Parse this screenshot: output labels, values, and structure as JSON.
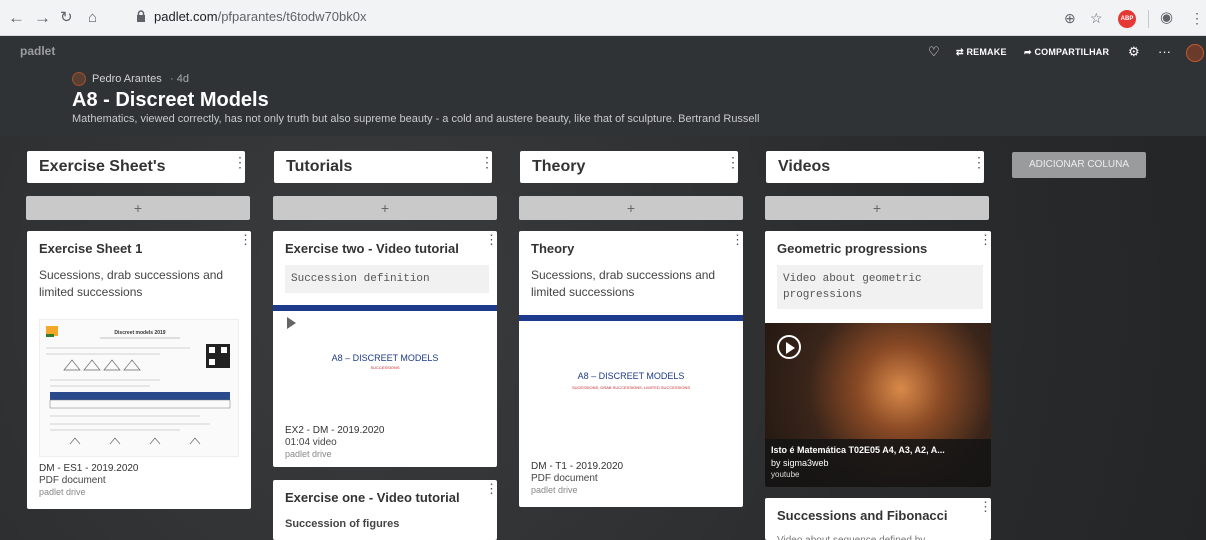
{
  "browser": {
    "url_host": "padlet.com",
    "url_path": "/pfparantes/t6todw70bk0x"
  },
  "header": {
    "logo": "padlet",
    "author": "Pedro Arantes",
    "time": "· 4d",
    "title": "A8 - Discreet Models",
    "subtitle": "Mathematics, viewed correctly, has not only truth but also supreme beauty - a cold and austere beauty, like that of sculpture. Bertrand Russell",
    "remake_label": "⇄ REMAKE",
    "share_label": "➦ COMPARTILHAR"
  },
  "columns": [
    {
      "title": "Exercise Sheet's"
    },
    {
      "title": "Tutorials"
    },
    {
      "title": "Theory"
    },
    {
      "title": "Videos"
    }
  ],
  "add_column_label": "ADICIONAR COLUNA",
  "add_symbol": "+",
  "cards": {
    "ex1": {
      "title": "Exercise Sheet 1",
      "body": "Sucessions, drab successions and limited successions",
      "thumb_title": "Discreet models 2019",
      "att_title": "DM - ES1 - 2019.2020",
      "att_type": "PDF document",
      "att_src": "padlet drive"
    },
    "tut2": {
      "title": "Exercise two - Video tutorial",
      "code": "Succession definition",
      "slide_title": "A8 – DISCREET MODELS",
      "slide_sub": "SUCCESSIONS",
      "att_title": "EX2 - DM - 2019.2020",
      "att_type": "01:04 video",
      "att_src": "padlet drive"
    },
    "tut1": {
      "title": "Exercise one - Video tutorial",
      "body": "Succession of figures"
    },
    "theory": {
      "title": "Theory",
      "body": "Sucessions, drab successions and limited successions",
      "slide_title": "A8 – DISCREET MODELS",
      "slide_sub": "SUCESSIONS, DRAB SUCCESSIONS, LIMITED SUCCESSIONS",
      "att_title": "DM - T1 - 2019.2020",
      "att_type": "PDF document",
      "att_src": "padlet drive"
    },
    "geo": {
      "title": "Geometric progressions",
      "code": "Video about geometric progressions",
      "vid_title": "Isto é Matemática T02E05 A4, A3, A2, A...",
      "vid_author": "by sigma3web",
      "vid_src": "youtube"
    },
    "fib": {
      "title": "Successions and Fibonacci",
      "body": "Video about sequence defined by..."
    }
  }
}
